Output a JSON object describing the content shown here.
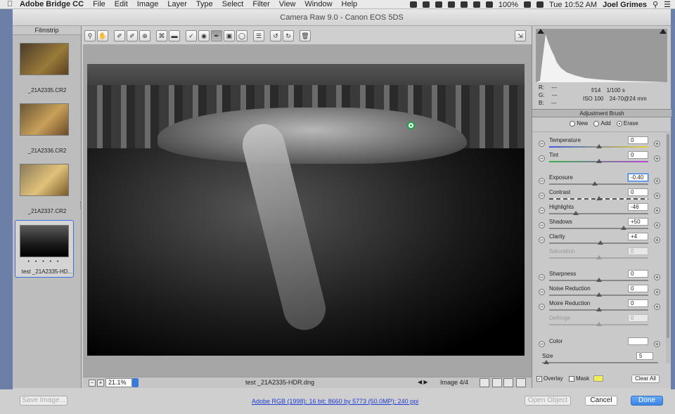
{
  "menubar": {
    "apple": "",
    "app": "Adobe Bridge CC",
    "items": [
      "File",
      "Edit",
      "Image",
      "Layer",
      "Type",
      "Select",
      "Filter",
      "View",
      "Window",
      "Help"
    ],
    "battery": "100%",
    "clock": "Tue 10:52 AM",
    "user": "Joel Grimes"
  },
  "window": {
    "title": "Camera Raw 9.0  -  Canon EOS 5DS"
  },
  "filmstrip": {
    "header": "Filmstrip",
    "items": [
      {
        "label": "_21A2335.CR2"
      },
      {
        "label": "_21A2336.CR2"
      },
      {
        "label": "_21A2337.CR2"
      },
      {
        "label": "test _21A2335-HD..."
      }
    ]
  },
  "toolbar": {
    "tools": [
      "zoom-icon",
      "hand-icon",
      "white-balance-icon",
      "color-sampler-icon",
      "target-adjust-icon",
      "crop-icon",
      "straighten-icon",
      "spot-removal-icon",
      "red-eye-icon",
      "adjustment-brush-icon",
      "graduated-filter-icon",
      "radial-filter-icon",
      "preferences-icon",
      "rotate-left-icon",
      "rotate-right-icon",
      "trash-icon"
    ],
    "fullscreen": "fullscreen-icon"
  },
  "status": {
    "zoom": "21.1%",
    "filename": "test _21A2335-HDR.dng",
    "image_count": "Image 4/4"
  },
  "histogram": {
    "r": "R:",
    "r_val": "---",
    "g": "G:",
    "g_val": "---",
    "b": "B:",
    "b_val": "---",
    "aperture": "f/14",
    "shutter": "1/100 s",
    "iso": "ISO 100",
    "lens": "24-70@24 mm"
  },
  "adjustment_brush": {
    "title": "Adjustment Brush",
    "mode_new": "New",
    "mode_add": "Add",
    "mode_erase": "Erase",
    "sliders": [
      {
        "label": "Temperature",
        "value": "0",
        "level": 0.5
      },
      {
        "label": "Tint",
        "value": "0",
        "level": 0.5
      },
      {
        "label": "Exposure",
        "value": "-0.40",
        "level": 0.46
      },
      {
        "label": "Contrast",
        "value": "0",
        "level": 0.5
      },
      {
        "label": "Highlights",
        "value": "-46",
        "level": 0.27
      },
      {
        "label": "Shadows",
        "value": "+50",
        "level": 0.75
      },
      {
        "label": "Clarity",
        "value": "+4",
        "level": 0.52
      },
      {
        "label": "Saturation",
        "value": "0",
        "level": 0.5
      },
      {
        "label": "Sharpness",
        "value": "0",
        "level": 0.5
      },
      {
        "label": "Noise Reduction",
        "value": "0",
        "level": 0.5
      },
      {
        "label": "Moire Reduction",
        "value": "0",
        "level": 0.5
      },
      {
        "label": "Defringe",
        "value": "0",
        "level": 0.5
      }
    ],
    "color_label": "Color",
    "size_label": "Size",
    "size_value": "5",
    "overlay_label": "Overlay",
    "mask_label": "Mask",
    "clear_all": "Clear All",
    "mask_color": "#f0ee52"
  },
  "footer": {
    "save_image": "Save Image...",
    "workflow": "Adobe RGB (1998); 16 bit; 8660 by 5773 (50.0MP); 240 ppi",
    "open_object": "Open Object",
    "cancel": "Cancel",
    "done": "Done"
  }
}
